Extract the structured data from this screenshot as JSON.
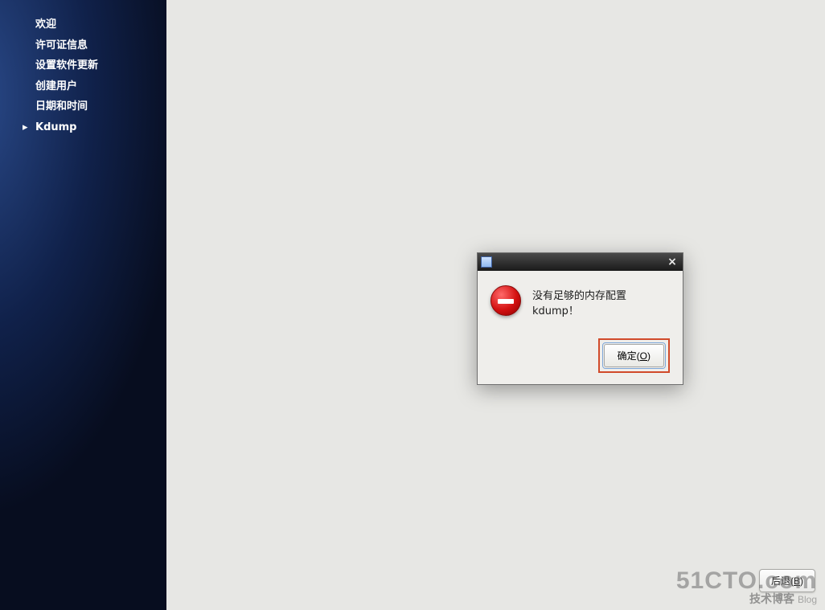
{
  "sidebar": {
    "items": [
      {
        "label": "欢迎",
        "active": false
      },
      {
        "label": "许可证信息",
        "active": false
      },
      {
        "label": "设置软件更新",
        "active": false
      },
      {
        "label": "创建用户",
        "active": false
      },
      {
        "label": "日期和时间",
        "active": false
      },
      {
        "label": "Kdump",
        "active": true
      }
    ]
  },
  "dialog": {
    "icon": "error-icon",
    "message": "没有足够的内存配置 kdump！",
    "ok_label": "确定(",
    "ok_mnemonic": "O",
    "ok_label_tail": ")"
  },
  "footer": {
    "back_label": "后退(",
    "back_mnemonic": "B",
    "back_label_tail": ")"
  },
  "watermark": {
    "line1": "51CTO.com",
    "line2": "技术博客",
    "line2_tail": "Blog"
  }
}
